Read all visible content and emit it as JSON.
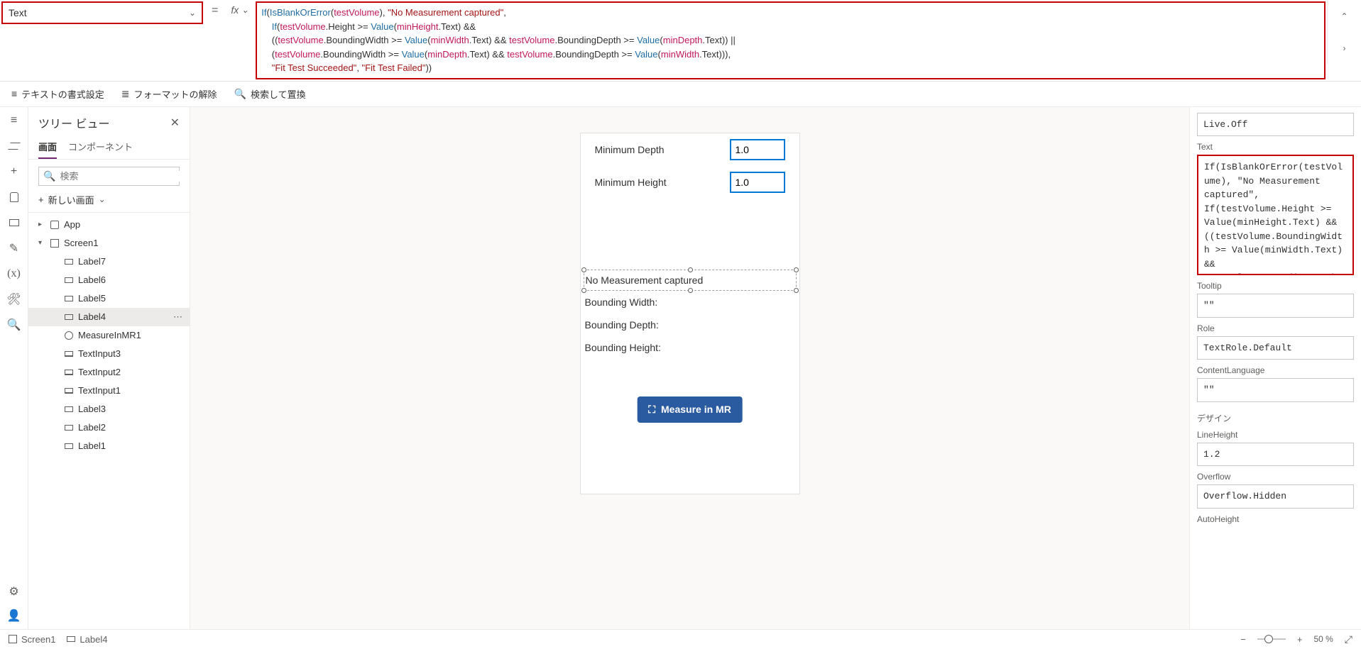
{
  "property_dropdown": "Text",
  "formula_lines": [
    {
      "segments": [
        {
          "t": "If",
          "c": "fn"
        },
        {
          "t": "(",
          "c": ""
        },
        {
          "t": "IsBlankOrError",
          "c": "fn"
        },
        {
          "t": "(",
          "c": ""
        },
        {
          "t": "testVolume",
          "c": "var"
        },
        {
          "t": "), ",
          "c": ""
        },
        {
          "t": "\"No Measurement captured\"",
          "c": "str"
        },
        {
          "t": ", ",
          "c": ""
        }
      ]
    },
    {
      "segments": [
        {
          "t": "    ",
          "c": ""
        },
        {
          "t": "If",
          "c": "fn"
        },
        {
          "t": "(",
          "c": ""
        },
        {
          "t": "testVolume",
          "c": "var"
        },
        {
          "t": ".Height >= ",
          "c": ""
        },
        {
          "t": "Value",
          "c": "fn"
        },
        {
          "t": "(",
          "c": ""
        },
        {
          "t": "minHeight",
          "c": "var"
        },
        {
          "t": ".Text) &&",
          "c": ""
        }
      ]
    },
    {
      "segments": [
        {
          "t": "    ((",
          "c": ""
        },
        {
          "t": "testVolume",
          "c": "var"
        },
        {
          "t": ".BoundingWidth >= ",
          "c": ""
        },
        {
          "t": "Value",
          "c": "fn"
        },
        {
          "t": "(",
          "c": ""
        },
        {
          "t": "minWidth",
          "c": "var"
        },
        {
          "t": ".Text) && ",
          "c": ""
        },
        {
          "t": "testVolume",
          "c": "var"
        },
        {
          "t": ".BoundingDepth >= ",
          "c": ""
        },
        {
          "t": "Value",
          "c": "fn"
        },
        {
          "t": "(",
          "c": ""
        },
        {
          "t": "minDepth",
          "c": "var"
        },
        {
          "t": ".Text)) ||",
          "c": ""
        }
      ]
    },
    {
      "segments": [
        {
          "t": "    (",
          "c": ""
        },
        {
          "t": "testVolume",
          "c": "var"
        },
        {
          "t": ".BoundingWidth >= ",
          "c": ""
        },
        {
          "t": "Value",
          "c": "fn"
        },
        {
          "t": "(",
          "c": ""
        },
        {
          "t": "minDepth",
          "c": "var"
        },
        {
          "t": ".Text) && ",
          "c": ""
        },
        {
          "t": "testVolume",
          "c": "var"
        },
        {
          "t": ".BoundingDepth >= ",
          "c": ""
        },
        {
          "t": "Value",
          "c": "fn"
        },
        {
          "t": "(",
          "c": ""
        },
        {
          "t": "minWidth",
          "c": "var"
        },
        {
          "t": ".Text))),",
          "c": ""
        }
      ]
    },
    {
      "segments": [
        {
          "t": "    ",
          "c": ""
        },
        {
          "t": "\"Fit Test Succeeded\"",
          "c": "str"
        },
        {
          "t": ", ",
          "c": ""
        },
        {
          "t": "\"Fit Test Failed\"",
          "c": "str"
        },
        {
          "t": "))",
          "c": ""
        }
      ]
    }
  ],
  "format_toolbar": {
    "text_format": "テキストの書式設定",
    "remove_format": "フォーマットの解除",
    "find_replace": "検索して置換"
  },
  "tree": {
    "title": "ツリー ビュー",
    "tabs": {
      "screens": "画面",
      "components": "コンポーネント"
    },
    "search_placeholder": "検索",
    "new_screen": "新しい画面",
    "items": [
      {
        "name": "App",
        "icon": "app",
        "indent": 0,
        "selected": false,
        "caret": "▶"
      },
      {
        "name": "Screen1",
        "icon": "rect",
        "indent": 0,
        "selected": false,
        "caret": "▼"
      },
      {
        "name": "Label7",
        "icon": "label",
        "indent": 1,
        "selected": false
      },
      {
        "name": "Label6",
        "icon": "label",
        "indent": 1,
        "selected": false
      },
      {
        "name": "Label5",
        "icon": "label",
        "indent": 1,
        "selected": false
      },
      {
        "name": "Label4",
        "icon": "label",
        "indent": 1,
        "selected": true,
        "dots": true
      },
      {
        "name": "MeasureInMR1",
        "icon": "mr",
        "indent": 1,
        "selected": false
      },
      {
        "name": "TextInput3",
        "icon": "text",
        "indent": 1,
        "selected": false
      },
      {
        "name": "TextInput2",
        "icon": "text",
        "indent": 1,
        "selected": false
      },
      {
        "name": "TextInput1",
        "icon": "text",
        "indent": 1,
        "selected": false
      },
      {
        "name": "Label3",
        "icon": "label",
        "indent": 1,
        "selected": false
      },
      {
        "name": "Label2",
        "icon": "label",
        "indent": 1,
        "selected": false
      },
      {
        "name": "Label1",
        "icon": "label",
        "indent": 1,
        "selected": false
      }
    ]
  },
  "canvas": {
    "min_depth_label": "Minimum Depth",
    "min_depth_value": "1.0",
    "min_height_label": "Minimum Height",
    "min_height_value": "1.0",
    "selected_text": "No Measurement captured",
    "bw": "Bounding Width:",
    "bd": "Bounding Depth:",
    "bh": "Bounding Height:",
    "measure_btn": "Measure in MR"
  },
  "props": {
    "live_value": "Live.Off",
    "text_label": "Text",
    "text_value": "If(IsBlankOrError(testVolume), \"No Measurement captured\",\nIf(testVolume.Height >= Value(minHeight.Text) && ((testVolume.BoundingWidth >= Value(minWidth.Text) && testVolume.BoundingDepth >= Value(minDepth.Text)) || (testVolume.BoundingWidth >= Value(minDepth.Text) &&",
    "tooltip_label": "Tooltip",
    "tooltip_value": "\"\"",
    "role_label": "Role",
    "role_value": "TextRole.Default",
    "cl_label": "ContentLanguage",
    "cl_value": "\"\"",
    "design_section": "デザイン",
    "lh_label": "LineHeight",
    "lh_value": "1.2",
    "of_label": "Overflow",
    "of_value": "Overflow.Hidden",
    "ah_label": "AutoHeight"
  },
  "footer": {
    "tabs": [
      {
        "icon": "rect",
        "label": "Screen1"
      },
      {
        "icon": "label",
        "label": "Label4"
      }
    ],
    "zoom": "50 %"
  }
}
